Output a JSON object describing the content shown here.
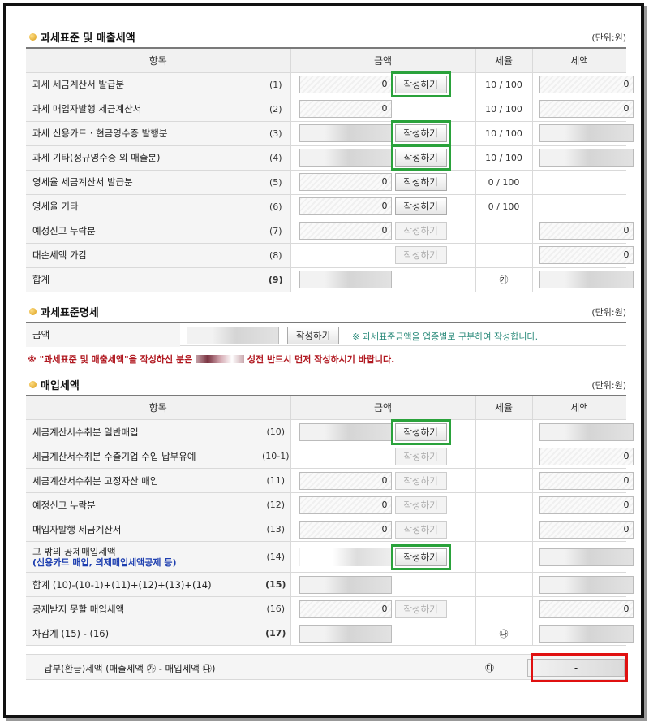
{
  "sales": {
    "title": "과세표준 및 매출세액",
    "unit": "(단위:원)",
    "headers": {
      "item": "항목",
      "amount": "금액",
      "rate": "세율",
      "tax": "세액"
    },
    "rows": [
      {
        "label": "과세 세금계산서 발급분",
        "no": "(1)",
        "amount": "0",
        "btn": "작성하기",
        "rate": "10 / 100",
        "tax": "0"
      },
      {
        "label": "과세 매입자발행 세금계산서",
        "no": "(2)",
        "amount": "0",
        "btn": "",
        "rate": "10 / 100",
        "tax": "0"
      },
      {
        "label": "과세 신용카드 · 현금영수증 발행분",
        "no": "(3)",
        "amount": "",
        "btn": "작성하기",
        "rate": "10 / 100",
        "tax": ""
      },
      {
        "label": "과세 기타(정규영수증 외 매출분)",
        "no": "(4)",
        "amount": "",
        "btn": "작성하기",
        "rate": "10 / 100",
        "tax": ""
      },
      {
        "label": "영세율 세금계산서 발급분",
        "no": "(5)",
        "amount": "0",
        "btn": "작성하기",
        "rate": "0 / 100",
        "tax": ""
      },
      {
        "label": "영세율 기타",
        "no": "(6)",
        "amount": "0",
        "btn": "작성하기",
        "rate": "0 / 100",
        "tax": ""
      },
      {
        "label": "예정신고 누락분",
        "no": "(7)",
        "amount": "0",
        "btn": "작성하기",
        "rate": "",
        "tax": "0"
      },
      {
        "label": "대손세액 가감",
        "no": "(8)",
        "amount": "",
        "btn": "작성하기",
        "rate": "",
        "tax": "0"
      },
      {
        "label": "합계",
        "no": "(9)",
        "amount": "",
        "btn": "",
        "rate": "㉮",
        "tax": ""
      }
    ]
  },
  "basis": {
    "title": "과세표준명세",
    "unit": "(단위:원)",
    "label": "금액",
    "btn": "작성하기",
    "note": "※ 과세표준금액을 업종별로 구분하여 작성합니다.",
    "warning_a": "※ \"과세표준 및 매출세액\"을 작성하신 분은",
    "warning_b": "성전 반드시 먼저 작성하시기 바랍니다."
  },
  "purchase": {
    "title": "매입세액",
    "unit": "(단위:원)",
    "headers": {
      "item": "항목",
      "amount": "금액",
      "rate": "세율",
      "tax": "세액"
    },
    "rows": [
      {
        "label": "세금계산서수취분 일반매입",
        "sub": "",
        "no": "(10)",
        "amount": "",
        "btn": "작성하기",
        "rate": "",
        "tax": ""
      },
      {
        "label": "세금계산서수취분 수출기업 수입 납부유예",
        "sub": "",
        "no": "(10-1)",
        "amount": "",
        "btn": "작성하기",
        "rate": "",
        "tax": "0"
      },
      {
        "label": "세금계산서수취분 고정자산 매입",
        "sub": "",
        "no": "(11)",
        "amount": "0",
        "btn": "작성하기",
        "rate": "",
        "tax": "0"
      },
      {
        "label": "예정신고 누락분",
        "sub": "",
        "no": "(12)",
        "amount": "0",
        "btn": "작성하기",
        "rate": "",
        "tax": "0"
      },
      {
        "label": "매입자발행 세금계산서",
        "sub": "",
        "no": "(13)",
        "amount": "0",
        "btn": "작성하기",
        "rate": "",
        "tax": "0"
      },
      {
        "label": "그 밖의 공제매입세액",
        "sub": "(신용카드 매입, 의제매입세액공제 등)",
        "no": "(14)",
        "amount": "",
        "btn": "작성하기",
        "rate": "",
        "tax": ""
      },
      {
        "label": "합계 (10)-(10-1)+(11)+(12)+(13)+(14)",
        "sub": "",
        "no": "(15)",
        "amount": "",
        "btn": "",
        "rate": "",
        "tax": ""
      },
      {
        "label": "공제받지 못할 매입세액",
        "sub": "",
        "no": "(16)",
        "amount": "0",
        "btn": "작성하기",
        "rate": "",
        "tax": "0"
      },
      {
        "label": "차감계 (15) - (16)",
        "sub": "",
        "no": "(17)",
        "amount": "",
        "btn": "",
        "rate": "㉯",
        "tax": ""
      }
    ]
  },
  "payment": {
    "label": "납부(환급)세액 (매출세액 ㉮ - 매입세액 ㉯)",
    "symbol": "㉰",
    "value": "-"
  }
}
